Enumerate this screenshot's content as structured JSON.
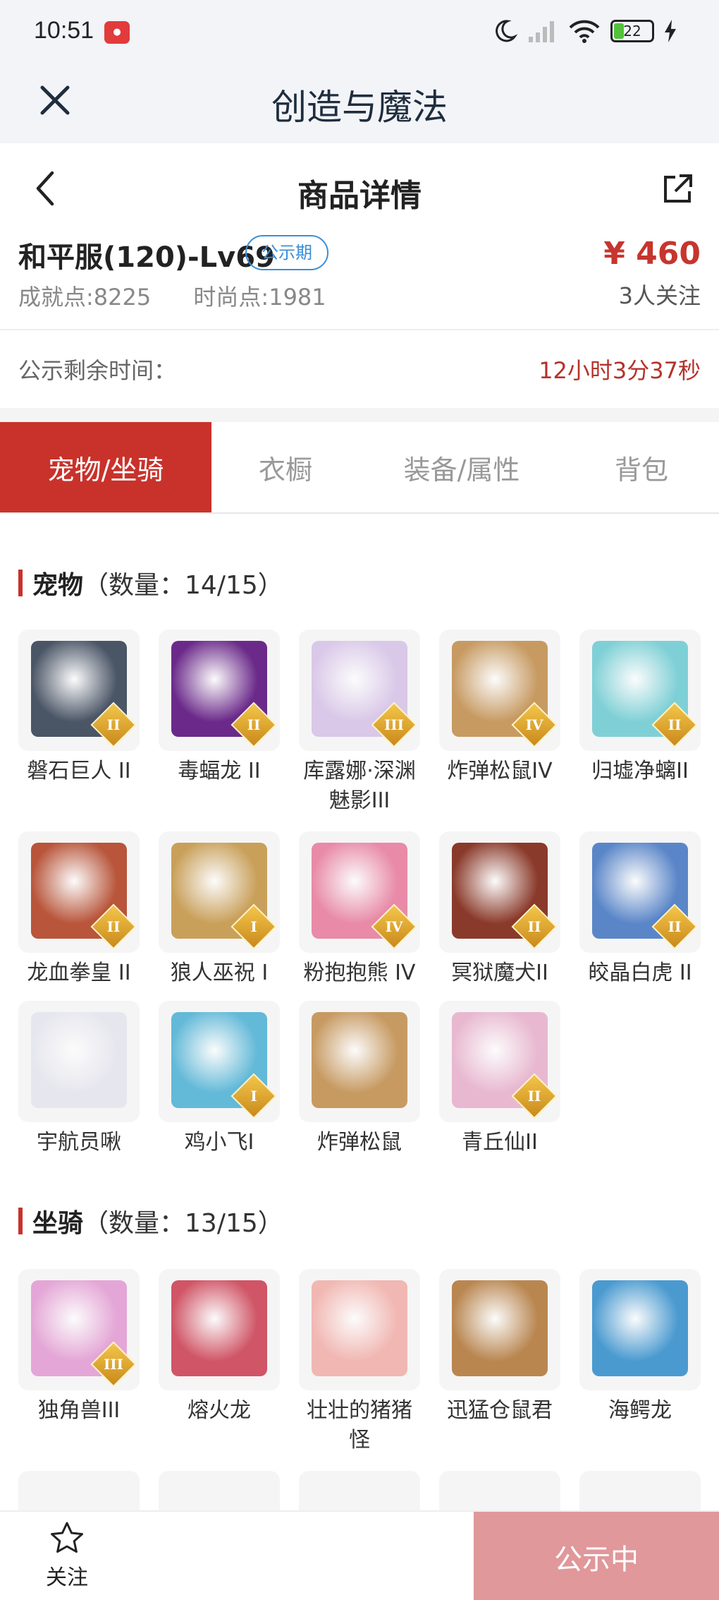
{
  "status_bar": {
    "time": "10:51",
    "battery": "22"
  },
  "app_bar": {
    "title": "创造与魔法"
  },
  "sub_header": {
    "title": "商品详情"
  },
  "item": {
    "title": "和平服(120)-Lv69",
    "badge": "公示期",
    "price": "¥ 460",
    "followers": "3人关注",
    "achievement_label": "成就点:",
    "achievement_value": "8225",
    "fashion_label": "时尚点:",
    "fashion_value": "1981"
  },
  "countdown": {
    "label": "公示剩余时间：",
    "value": "12小时3分37秒"
  },
  "tabs": [
    {
      "label": "宠物/坐骑",
      "active": true
    },
    {
      "label": "衣橱",
      "active": false
    },
    {
      "label": "装备/属性",
      "active": false
    },
    {
      "label": "背包",
      "active": false
    }
  ],
  "pets": {
    "title": "宠物",
    "count": "（数量：14/15）",
    "items": [
      {
        "name": "磐石巨人 II",
        "rank": "II",
        "color": "#4a5566"
      },
      {
        "name": "毒蝠龙 II",
        "rank": "II",
        "color": "#6b2a8a"
      },
      {
        "name": "库露娜·深渊魅影III",
        "rank": "III",
        "color": "#d9c8e8"
      },
      {
        "name": "炸弹松鼠IV",
        "rank": "IV",
        "color": "#c79a62"
      },
      {
        "name": "归墟净螭II",
        "rank": "II",
        "color": "#7fd0d6"
      },
      {
        "name": "龙血拳皇 II",
        "rank": "II",
        "color": "#b8553a"
      },
      {
        "name": "狼人巫祝 I",
        "rank": "I",
        "color": "#c9a05a"
      },
      {
        "name": "粉抱抱熊 IV",
        "rank": "IV",
        "color": "#e88aa8"
      },
      {
        "name": "冥狱魔犬II",
        "rank": "II",
        "color": "#8a3a2a"
      },
      {
        "name": "皎晶白虎 II",
        "rank": "II",
        "color": "#5a86c8"
      },
      {
        "name": "宇航员啾",
        "rank": "",
        "color": "#e6e6ee"
      },
      {
        "name": "鸡小飞I",
        "rank": "I",
        "color": "#62b9d8"
      },
      {
        "name": "炸弹松鼠",
        "rank": "",
        "color": "#c79a62"
      },
      {
        "name": "青丘仙II",
        "rank": "II",
        "color": "#e8b8d0"
      }
    ]
  },
  "mounts": {
    "title": "坐骑",
    "count": "（数量：13/15）",
    "items": [
      {
        "name": "独角兽III",
        "rank": "III",
        "color": "#e4a6d6"
      },
      {
        "name": "熔火龙",
        "rank": "",
        "color": "#d05566"
      },
      {
        "name": "壮壮的猪猪怪",
        "rank": "",
        "color": "#f1b7b2"
      },
      {
        "name": "迅猛仓鼠君",
        "rank": "",
        "color": "#b98650"
      },
      {
        "name": "海鳄龙",
        "rank": "",
        "color": "#4a9ad0"
      }
    ]
  },
  "bottom": {
    "follow_label": "关注",
    "action_label": "公示中"
  }
}
